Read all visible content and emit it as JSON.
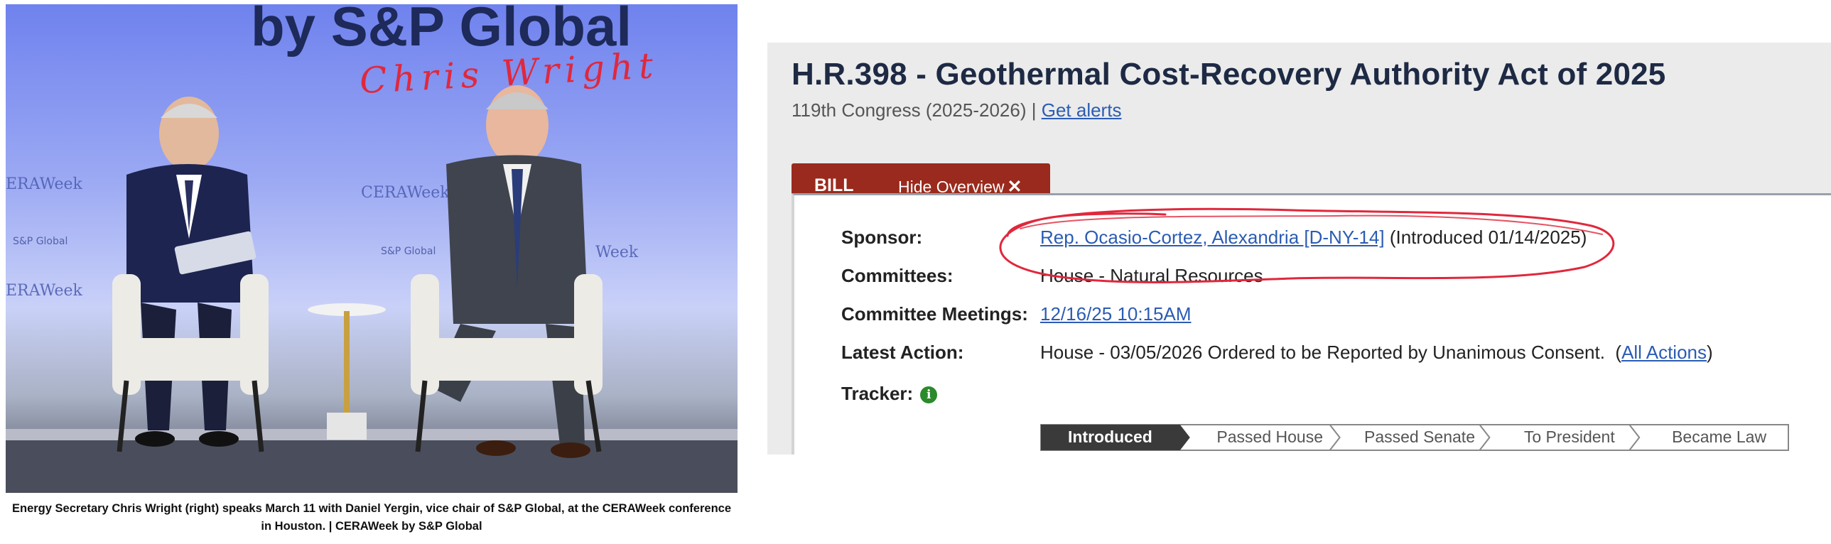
{
  "photo": {
    "banner_text": "by S&P Global",
    "handwritten_label": "Chris Wright",
    "background_logos": [
      "CERAWeek",
      "S&P Global"
    ],
    "caption": "Energy Secretary Chris Wright (right) speaks March 11 with Daniel Yergin, vice chair of S&P Global, at the CERAWeek conference in Houston. | CERAWeek by S&P Global"
  },
  "bill": {
    "title": "H.R.398 - Geothermal Cost-Recovery Authority Act of 2025",
    "congress": "119th Congress (2025-2026) |",
    "alerts_link": "Get alerts",
    "tab_label": "BILL",
    "hide_overview_label": "Hide Overview",
    "hide_icon": "close-icon",
    "overview": {
      "sponsor_label": "Sponsor:",
      "sponsor_link": "Rep. Ocasio-Cortez, Alexandria [D-NY-14]",
      "sponsor_note": "(Introduced 01/14/2025)",
      "committees_label": "Committees:",
      "committees_value": "House - Natural Resources",
      "meetings_label": "Committee Meetings:",
      "meetings_link": "12/16/25 10:15AM",
      "latest_action_label": "Latest Action:",
      "latest_action_value": "House - 03/05/2026 Ordered to be Reported by Unanimous Consent.",
      "all_actions_open": "(",
      "all_actions_link": "All Actions",
      "all_actions_close": ")",
      "tracker_label": "Tracker:",
      "tracker_info_icon": "info-icon"
    },
    "tracker_steps": [
      "Introduced",
      "Passed House",
      "Passed Senate",
      "To President",
      "Became Law"
    ],
    "tracker_active_index": 0
  },
  "colors": {
    "tab_red": "#9a2a1d",
    "link_blue": "#2b5cb3",
    "annotation_red": "#e0283c",
    "title_navy": "#1e2a44",
    "tracker_dark": "#3a3a3a",
    "info_green": "#2b8a2b"
  }
}
